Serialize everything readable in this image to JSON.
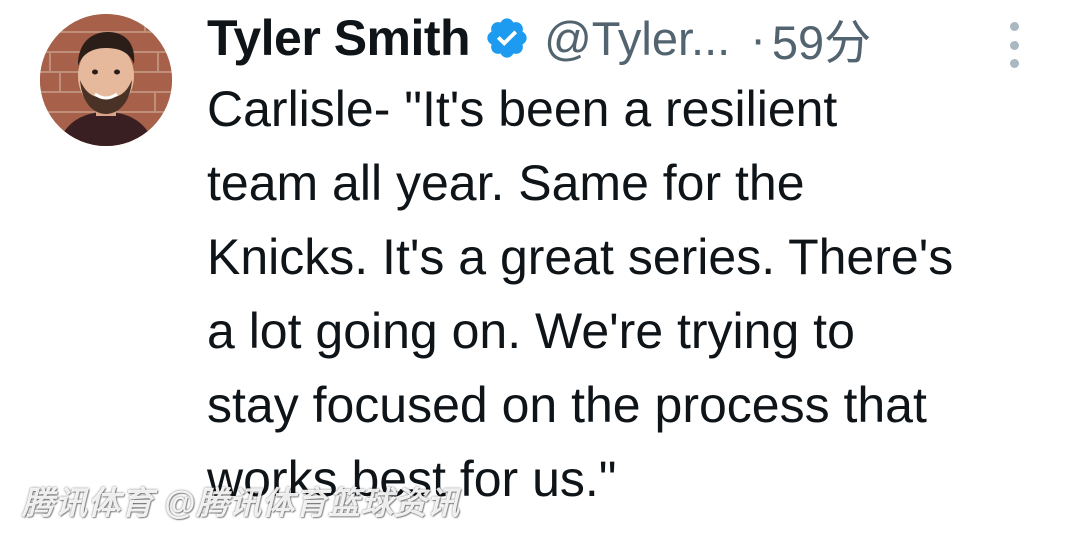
{
  "tweet": {
    "author_name": "Tyler Smith",
    "handle": "@Tyler...",
    "separator": "·",
    "timestamp": "59分",
    "text": "Carlisle- \"It's been a resilient\nteam all year. Same for the\nKnicks. It's a great series. There's\na lot going on. We're trying to\nstay focused on the process that\nworks best for us.\"",
    "verified_icon": "verified-badge-icon",
    "more_icon": "more-options-icon"
  },
  "watermark": {
    "text": "腾讯体育 @腾讯体育篮球资讯"
  },
  "colors": {
    "text": "#0f1419",
    "secondary": "#536471",
    "verified": "#1d9bf0"
  }
}
